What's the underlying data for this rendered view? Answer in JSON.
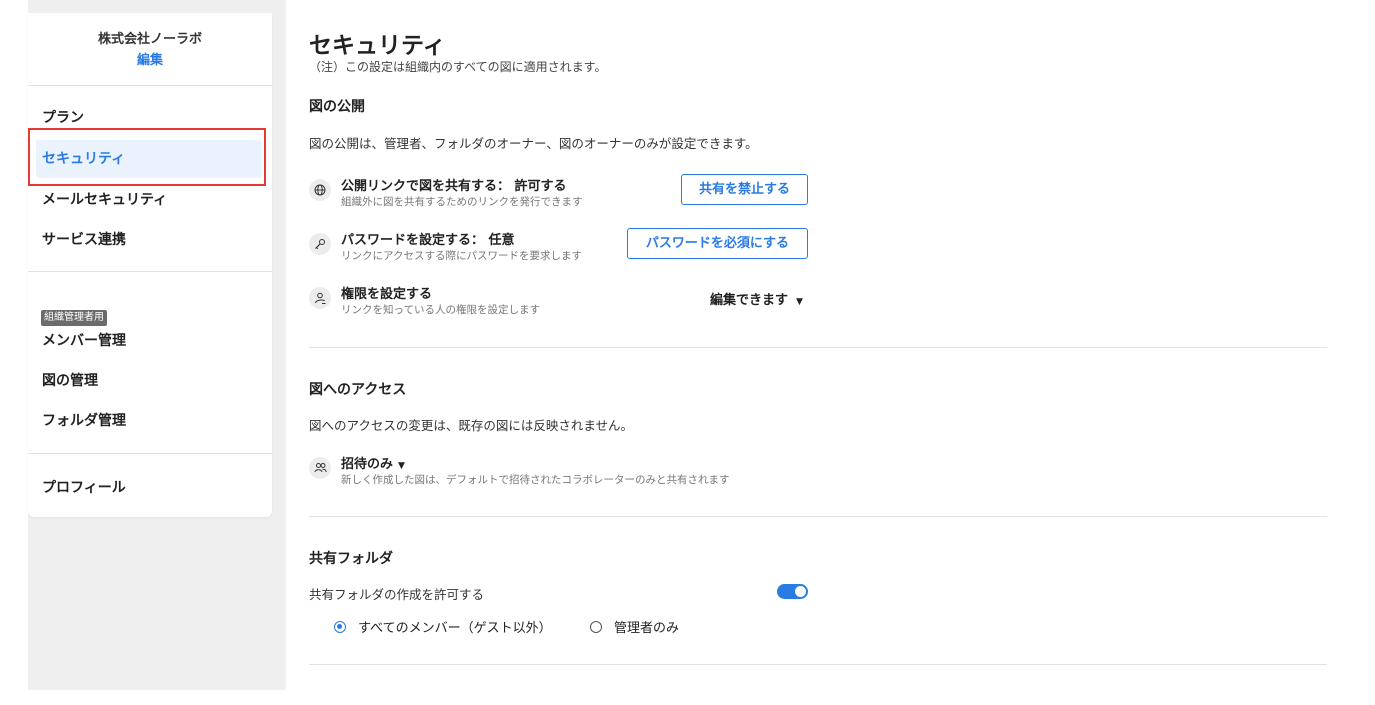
{
  "sidebar": {
    "org_name": "株式会社ノーラボ",
    "edit_label": "編集",
    "items": [
      {
        "label": "プラン"
      },
      {
        "label": "セキュリティ"
      },
      {
        "label": "メールセキュリティ"
      },
      {
        "label": "サービス連携"
      }
    ],
    "admin_badge": "組織管理者用",
    "admin_items": [
      {
        "label": "メンバー管理"
      },
      {
        "label": "図の管理"
      },
      {
        "label": "フォルダ管理"
      }
    ],
    "profile_label": "プロフィール",
    "active_item": "セキュリティ"
  },
  "main": {
    "title": "セキュリティ",
    "note": "（注）この設定は組織内のすべての図に適用されます。",
    "publish": {
      "heading": "図の公開",
      "description": "図の公開は、管理者、フォルダのオーナー、図のオーナーのみが設定できます。",
      "rows": [
        {
          "icon": "globe-icon",
          "title": "公開リンクで図を共有する： 許可する",
          "sub": "組織外に図を共有するためのリンクを発行できます",
          "button": "共有を禁止する"
        },
        {
          "icon": "key-icon",
          "title": "パスワードを設定する： 任意",
          "sub": "リンクにアクセスする際にパスワードを要求します",
          "button": "パスワードを必須にする"
        },
        {
          "icon": "user-permission-icon",
          "title": "権限を設定する",
          "sub": "リンクを知っている人の権限を設定します",
          "select": "編集できます"
        }
      ]
    },
    "access": {
      "heading": "図へのアクセス",
      "description": "図へのアクセスの変更は、既存の図には反映されません。",
      "row": {
        "icon": "users-icon",
        "title": "招待のみ",
        "sub": "新しく作成した図は、デフォルトで招待されたコラボレーターのみと共有されます"
      }
    },
    "shared_folder": {
      "heading": "共有フォルダ",
      "toggle_label": "共有フォルダの作成を許可する",
      "toggle_on": true,
      "options": [
        {
          "label": "すべてのメンバー（ゲスト以外）",
          "selected": true
        },
        {
          "label": "管理者のみ",
          "selected": false
        }
      ]
    }
  },
  "colors": {
    "accent": "#2a7be4",
    "highlight": "#e53935",
    "sidebar_bg": "#efefef"
  }
}
